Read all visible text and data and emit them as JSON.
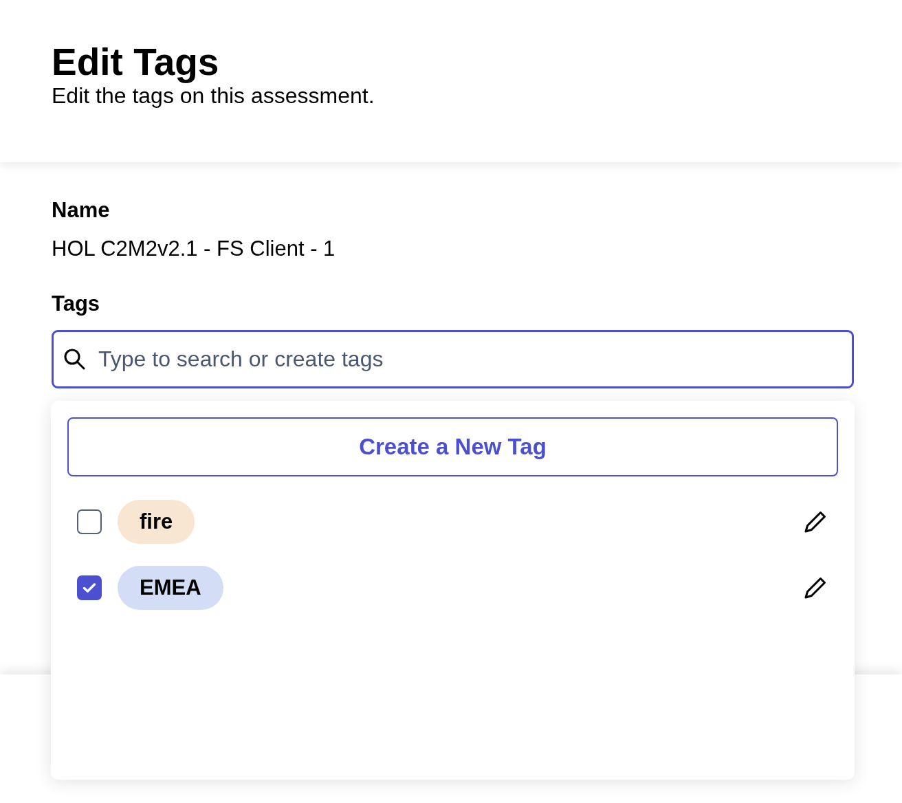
{
  "header": {
    "title": "Edit Tags",
    "subtitle": "Edit the tags on this assessment."
  },
  "fields": [
    {
      "label": "Name",
      "value": "HOL C2M2v2.1 - FS Client - 1"
    }
  ],
  "tags_field": {
    "label": "Tags",
    "placeholder": "Type to search or create tags",
    "focused": true
  },
  "dropdown": {
    "create_button": "Create a New Tag",
    "tags": [
      {
        "name": "fire",
        "checked": false,
        "color": "#f8e6d3"
      },
      {
        "name": "EMEA",
        "checked": true,
        "color": "#d3ddf5"
      }
    ]
  }
}
